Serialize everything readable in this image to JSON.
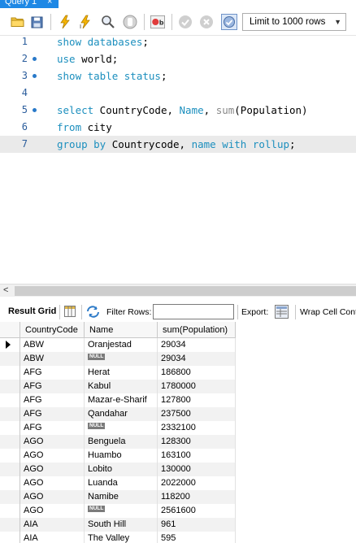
{
  "tab": {
    "title": "Query 1",
    "close": "×"
  },
  "toolbar": {
    "icons": [
      "open-folder-icon",
      "save-icon",
      "execute-icon",
      "execute-current-icon",
      "explain-icon",
      "stop-icon",
      "toggle-continue-icon",
      "commit-icon",
      "rollback-icon",
      "autocommit-icon"
    ],
    "limit_value": "Limit to 1000 rows"
  },
  "editor": {
    "lines": [
      {
        "num": "1",
        "dot": false,
        "current": false
      },
      {
        "num": "2",
        "dot": true,
        "current": false
      },
      {
        "num": "3",
        "dot": true,
        "current": false
      },
      {
        "num": "4",
        "dot": false,
        "current": false
      },
      {
        "num": "5",
        "dot": true,
        "current": false
      },
      {
        "num": "6",
        "dot": false,
        "current": false
      },
      {
        "num": "7",
        "dot": false,
        "current": true
      }
    ],
    "code": {
      "l1": {
        "kw1": "show databases",
        "rest": ";"
      },
      "l2": {
        "kw1": "use",
        "rest": " world;"
      },
      "l3": {
        "kw1": "show table status",
        "rest": ";"
      },
      "l5": {
        "kw1": "select",
        "a": " CountryCode, ",
        "kw2": "Name",
        "b": ", ",
        "fn": "sum",
        "c": "(Population)"
      },
      "l6": {
        "kw1": "from",
        "a": " city"
      },
      "l7": {
        "kw1": "group by",
        "a": " Countrycode, ",
        "kw2": "name",
        "b": " ",
        "kw3": "with rollup",
        "c": ";"
      }
    }
  },
  "hscroll": {
    "left_arrow": "<"
  },
  "result_toolbar": {
    "result_grid_label": "Result Grid",
    "filter_label": "Filter Rows:",
    "filter_value": "",
    "export_label": "Export:",
    "wrap_label": "Wrap Cell Cont"
  },
  "grid": {
    "columns": [
      "CountryCode",
      "Name",
      "sum(Population)"
    ],
    "null_label": "NULL",
    "rows": [
      {
        "code": "ABW",
        "name": "Oranjestad",
        "pop": "29034",
        "null": false
      },
      {
        "code": "ABW",
        "name": "",
        "pop": "29034",
        "null": true
      },
      {
        "code": "AFG",
        "name": "Herat",
        "pop": "186800",
        "null": false
      },
      {
        "code": "AFG",
        "name": "Kabul",
        "pop": "1780000",
        "null": false
      },
      {
        "code": "AFG",
        "name": "Mazar-e-Sharif",
        "pop": "127800",
        "null": false
      },
      {
        "code": "AFG",
        "name": "Qandahar",
        "pop": "237500",
        "null": false
      },
      {
        "code": "AFG",
        "name": "",
        "pop": "2332100",
        "null": true
      },
      {
        "code": "AGO",
        "name": "Benguela",
        "pop": "128300",
        "null": false
      },
      {
        "code": "AGO",
        "name": "Huambo",
        "pop": "163100",
        "null": false
      },
      {
        "code": "AGO",
        "name": "Lobito",
        "pop": "130000",
        "null": false
      },
      {
        "code": "AGO",
        "name": "Luanda",
        "pop": "2022000",
        "null": false
      },
      {
        "code": "AGO",
        "name": "Namibe",
        "pop": "118200",
        "null": false
      },
      {
        "code": "AGO",
        "name": "",
        "pop": "2561600",
        "null": true
      },
      {
        "code": "AIA",
        "name": "South Hill",
        "pop": "961",
        "null": false
      },
      {
        "code": "AIA",
        "name": "The Valley",
        "pop": "595",
        "null": false
      }
    ]
  }
}
